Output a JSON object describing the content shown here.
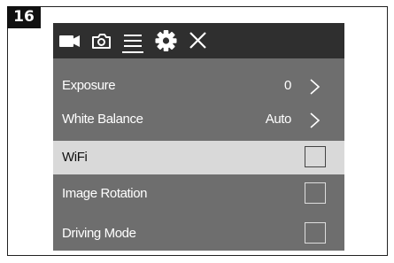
{
  "step_number": "16",
  "toolbar": {
    "icons": [
      "video-camera-icon",
      "photo-camera-icon",
      "menu-icon",
      "gear-icon",
      "close-icon"
    ],
    "active": "menu-icon"
  },
  "menu": {
    "items": [
      {
        "label": "Exposure",
        "value": "0",
        "control": "chevron",
        "selected": false
      },
      {
        "label": "White Balance",
        "value": "Auto",
        "control": "chevron",
        "selected": false
      },
      {
        "label": "WiFi",
        "control": "checkbox",
        "checked": false,
        "selected": true
      },
      {
        "label": "Image Rotation",
        "control": "checkbox",
        "checked": false,
        "selected": false
      },
      {
        "label": "Driving Mode",
        "control": "checkbox",
        "checked": false,
        "selected": false
      }
    ]
  },
  "colors": {
    "toolbar_bg": "#2f2f2f",
    "menu_bg": "#6e6e6e",
    "selected_row_bg": "#d9d9d9",
    "text": "#ffffff",
    "selected_text": "#111111"
  }
}
